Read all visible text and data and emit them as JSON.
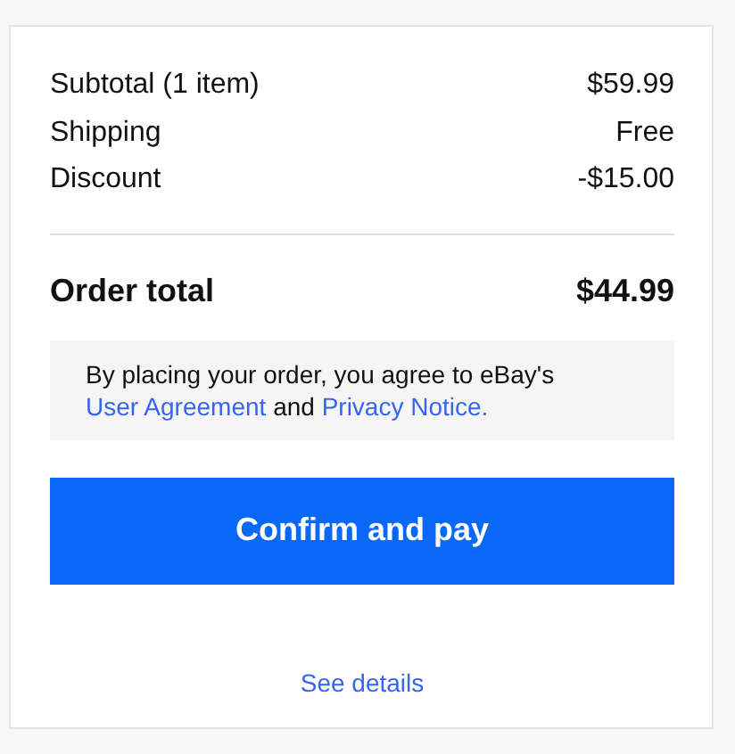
{
  "summary": {
    "lines": [
      {
        "label": "Subtotal (1 item)",
        "value": "$59.99"
      },
      {
        "label": "Shipping",
        "value": "Free"
      },
      {
        "label": "Discount",
        "value": "-$15.00"
      }
    ],
    "total": {
      "label": "Order total",
      "value": "$44.99"
    }
  },
  "agreement": {
    "text": "By placing your order, you agree to eBay's",
    "links": [
      "User Agreement",
      "Privacy Notice."
    ],
    "joiner": "and"
  },
  "confirm_button": "Confirm and pay",
  "details_link": "See details"
}
